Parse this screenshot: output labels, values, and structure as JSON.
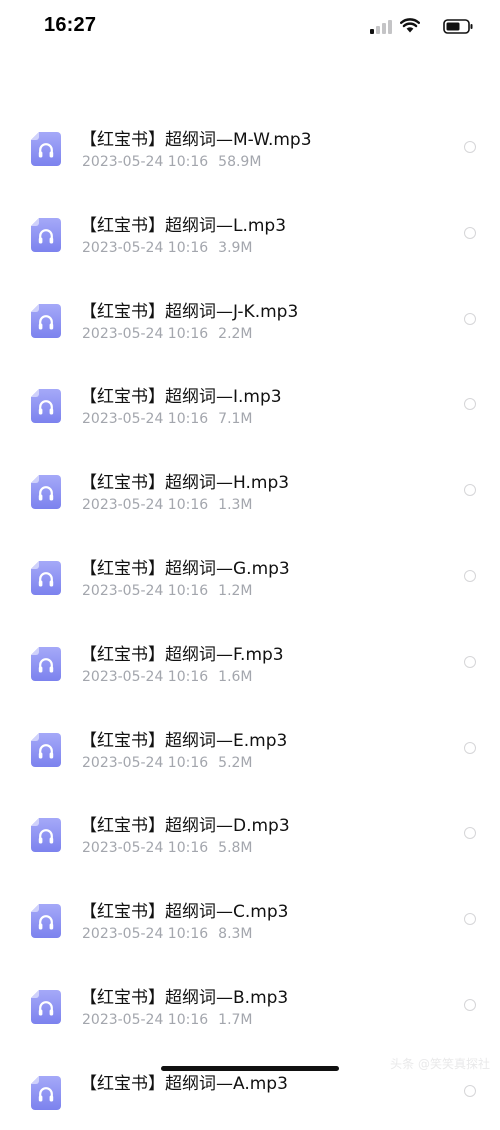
{
  "status_bar": {
    "time": "16:27",
    "icons": [
      "cellular-signal-icon",
      "wifi-icon",
      "battery-icon"
    ]
  },
  "files": [
    {
      "name": "【红宝书】超纲词—M-W.mp3",
      "date": "2023-05-24 10:16",
      "size": "58.9M",
      "icon": "headphones-icon"
    },
    {
      "name": "【红宝书】超纲词—L.mp3",
      "date": "2023-05-24 10:16",
      "size": "3.9M",
      "icon": "headphones-icon"
    },
    {
      "name": "【红宝书】超纲词—J-K.mp3",
      "date": "2023-05-24 10:16",
      "size": "2.2M",
      "icon": "headphones-icon"
    },
    {
      "name": "【红宝书】超纲词—I.mp3",
      "date": "2023-05-24 10:16",
      "size": "7.1M",
      "icon": "headphones-icon"
    },
    {
      "name": "【红宝书】超纲词—H.mp3",
      "date": "2023-05-24 10:16",
      "size": "1.3M",
      "icon": "headphones-icon"
    },
    {
      "name": "【红宝书】超纲词—G.mp3",
      "date": "2023-05-24 10:16",
      "size": "1.2M",
      "icon": "headphones-icon"
    },
    {
      "name": "【红宝书】超纲词—F.mp3",
      "date": "2023-05-24 10:16",
      "size": "1.6M",
      "icon": "headphones-icon"
    },
    {
      "name": "【红宝书】超纲词—E.mp3",
      "date": "2023-05-24 10:16",
      "size": "5.2M",
      "icon": "headphones-icon"
    },
    {
      "name": "【红宝书】超纲词—D.mp3",
      "date": "2023-05-24 10:16",
      "size": "5.8M",
      "icon": "headphones-icon"
    },
    {
      "name": "【红宝书】超纲词—C.mp3",
      "date": "2023-05-24 10:16",
      "size": "8.3M",
      "icon": "headphones-icon"
    },
    {
      "name": "【红宝书】超纲词—B.mp3",
      "date": "2023-05-24 10:16",
      "size": "1.7M",
      "icon": "headphones-icon"
    },
    {
      "name": "【红宝书】超纲词—A.mp3",
      "date": "",
      "size": "",
      "icon": "headphones-icon"
    }
  ],
  "watermark": "头条 @笑笑真探社",
  "colors": {
    "icon_gradient_top": "#a5a9f8",
    "icon_gradient_bottom": "#7c82ee",
    "meta_text": "#a3a6ad",
    "radio_border": "#d6d6d8"
  }
}
